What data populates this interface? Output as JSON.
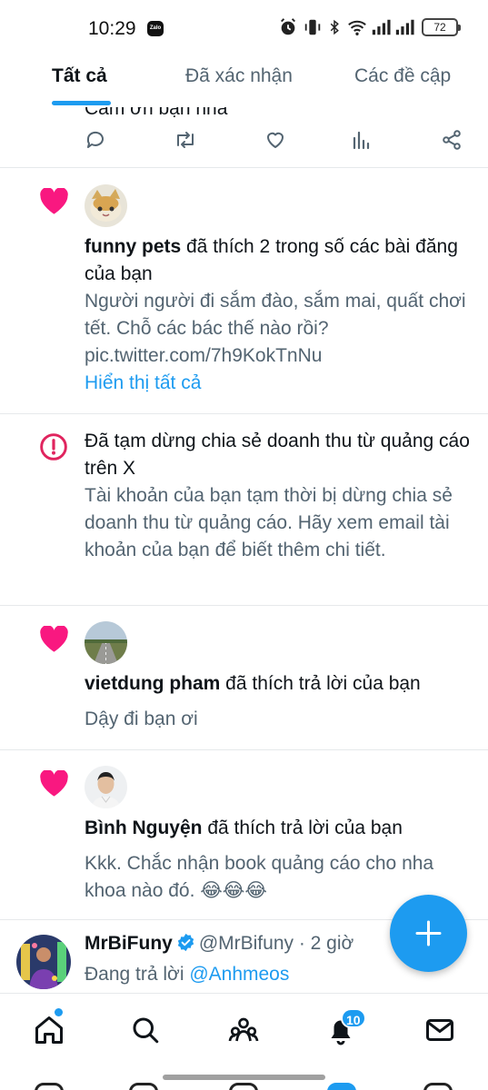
{
  "status_bar": {
    "time": "10:29",
    "zalo_label": "Zalo",
    "battery": "72"
  },
  "tabs": [
    {
      "label": "Tất cả",
      "active": true
    },
    {
      "label": "Đã xác nhận",
      "active": false
    },
    {
      "label": "Các đề cập",
      "active": false
    }
  ],
  "feed": {
    "cut_text": "Cảm ơn bạn nha",
    "action_icons": [
      "reply-icon",
      "retweet-icon",
      "like-icon",
      "views-icon",
      "share-icon"
    ],
    "notifications": [
      {
        "type": "like",
        "user": "funny pets",
        "action": " đã thích 2 trong số các bài đăng của bạn",
        "excerpt": "Người người đi sắm đào, sắm mai, quất chơi tết. Chỗ các bác thế nào rồi? pic.twitter.com/7h9KokTnNu",
        "show_all": "Hiển thị tất cả"
      },
      {
        "type": "alert",
        "title": "Đã tạm dừng chia sẻ doanh thu từ quảng cáo trên X",
        "body": "Tài khoản của bạn tạm thời bị dừng chia sẻ doanh thu từ quảng cáo. Hãy xem email tài khoản của bạn để biết thêm chi tiết."
      },
      {
        "type": "like",
        "user": "vietdung pham",
        "action": " đã thích trả lời của bạn",
        "excerpt": "Dậy đi bạn ơi"
      },
      {
        "type": "like",
        "user": "Bình Nguyện",
        "action": " đã thích trả lời của bạn",
        "excerpt": "Kkk. Chắc nhận book quảng cáo cho nha khoa nào đó.  😂😂😂"
      }
    ],
    "reply_tweet": {
      "name": "MrBiFuny",
      "handle": "@MrBifuny",
      "time": "· 2 giờ",
      "replying_prefix": "Đang trả lời",
      "replying_to": "@Anhmeos"
    }
  },
  "bottom_nav": {
    "items": [
      "home-icon",
      "search-icon",
      "communities-icon",
      "notifications-icon",
      "messages-icon"
    ],
    "notification_count": "10"
  },
  "colors": {
    "accent": "#1d9bf0",
    "like": "#f91880",
    "alert": "#e0245e",
    "secondary_text": "#536471"
  }
}
